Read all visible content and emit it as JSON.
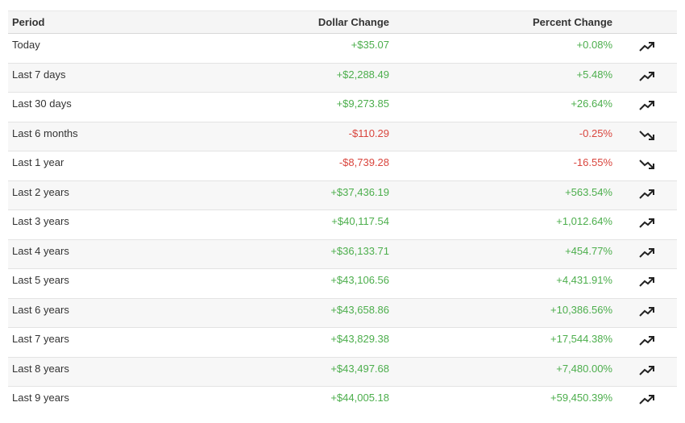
{
  "table": {
    "headers": {
      "period": "Period",
      "dollar": "Dollar Change",
      "percent": "Percent Change"
    },
    "rows": [
      {
        "period": "Today",
        "dollar": "+$35.07",
        "percent": "+0.08%",
        "direction": "up",
        "trend_icon": "trending-up-icon"
      },
      {
        "period": "Last 7 days",
        "dollar": "+$2,288.49",
        "percent": "+5.48%",
        "direction": "up",
        "trend_icon": "trending-up-icon"
      },
      {
        "period": "Last 30 days",
        "dollar": "+$9,273.85",
        "percent": "+26.64%",
        "direction": "up",
        "trend_icon": "trending-up-icon"
      },
      {
        "period": "Last 6 months",
        "dollar": "-$110.29",
        "percent": "-0.25%",
        "direction": "down",
        "trend_icon": "trending-down-icon"
      },
      {
        "period": "Last 1 year",
        "dollar": "-$8,739.28",
        "percent": "-16.55%",
        "direction": "down",
        "trend_icon": "trending-down-icon"
      },
      {
        "period": "Last 2 years",
        "dollar": "+$37,436.19",
        "percent": "+563.54%",
        "direction": "up",
        "trend_icon": "trending-up-icon"
      },
      {
        "period": "Last 3 years",
        "dollar": "+$40,117.54",
        "percent": "+1,012.64%",
        "direction": "up",
        "trend_icon": "trending-up-icon"
      },
      {
        "period": "Last 4 years",
        "dollar": "+$36,133.71",
        "percent": "+454.77%",
        "direction": "up",
        "trend_icon": "trending-up-icon"
      },
      {
        "period": "Last 5 years",
        "dollar": "+$43,106.56",
        "percent": "+4,431.91%",
        "direction": "up",
        "trend_icon": "trending-up-icon"
      },
      {
        "period": "Last 6 years",
        "dollar": "+$43,658.86",
        "percent": "+10,386.56%",
        "direction": "up",
        "trend_icon": "trending-up-icon"
      },
      {
        "period": "Last 7 years",
        "dollar": "+$43,829.38",
        "percent": "+17,544.38%",
        "direction": "up",
        "trend_icon": "trending-up-icon"
      },
      {
        "period": "Last 8 years",
        "dollar": "+$43,497.68",
        "percent": "+7,480.00%",
        "direction": "up",
        "trend_icon": "trending-up-icon"
      },
      {
        "period": "Last 9 years",
        "dollar": "+$44,005.18",
        "percent": "+59,450.39%",
        "direction": "up",
        "trend_icon": "trending-up-icon"
      }
    ]
  },
  "colors": {
    "positive": "#4cae4c",
    "negative": "#d9453d",
    "text": "#333333",
    "header_bg": "#f5f5f5",
    "stripe_bg": "#f7f7f7"
  }
}
